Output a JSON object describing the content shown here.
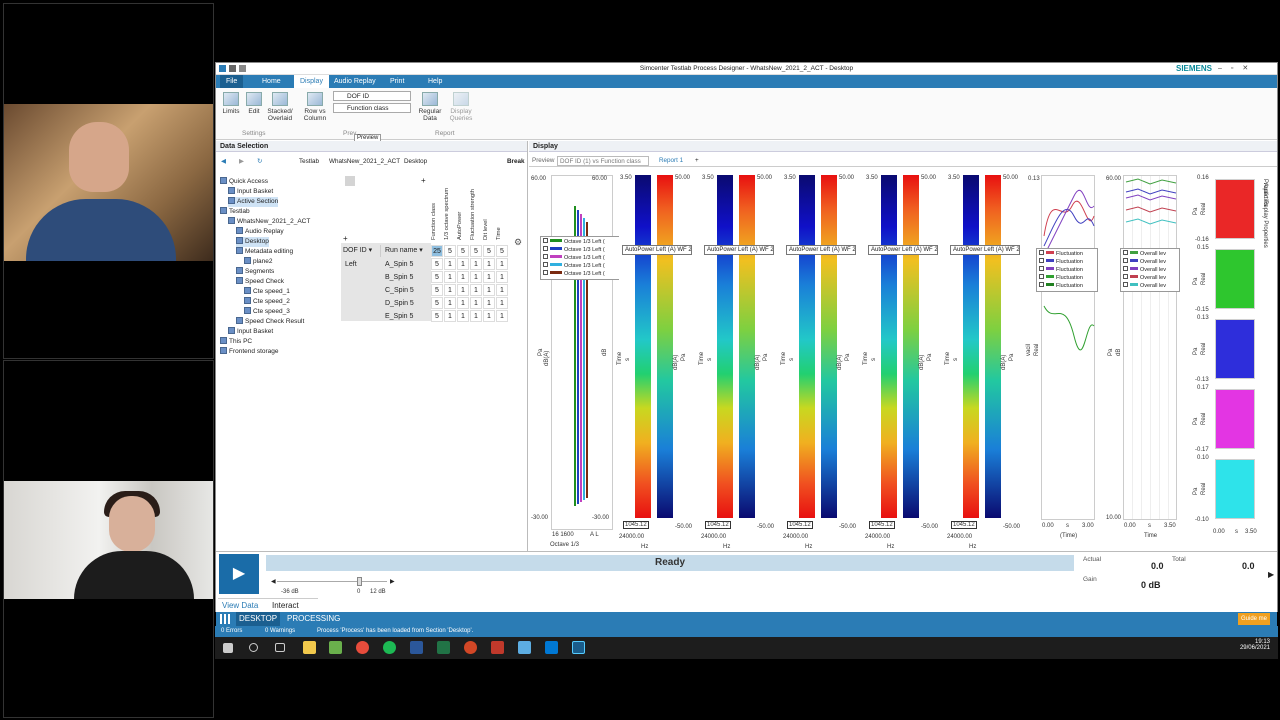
{
  "app": {
    "title": "Simcenter Testlab Process Designer - WhatsNew_2021_2_ACT - Desktop",
    "brand": "SIEMENS",
    "tabs": [
      "File",
      "Home",
      "Display",
      "Audio Replay",
      "Print",
      "Help"
    ],
    "active_tab": "Display"
  },
  "ribbon": {
    "limits": "Limits",
    "edit": "Edit",
    "stacked": "Stacked/ Overlaid",
    "rowcol": "Row vs Column",
    "dof_id": "DOF ID",
    "function_class": "Function class",
    "regular_data": "Regular Data",
    "display_queries": "Display Queries",
    "group_settings": "Settings",
    "group_preview": "Prev",
    "group_report": "Report",
    "tooltip": "Preview"
  },
  "data_selection": {
    "title": "Data Selection",
    "breadcrumb": [
      "Testlab",
      "WhatsNew_2021_2_ACT",
      "Desktop"
    ],
    "break_label": "Break",
    "tree": [
      {
        "label": "Quick Access",
        "indent": 0
      },
      {
        "label": "Input Basket",
        "indent": 1
      },
      {
        "label": "Active Section",
        "indent": 1
      },
      {
        "label": "Testlab",
        "indent": 0
      },
      {
        "label": "WhatsNew_2021_2_ACT",
        "indent": 1
      },
      {
        "label": "Audio Replay",
        "indent": 2
      },
      {
        "label": "Desktop",
        "indent": 2
      },
      {
        "label": "Metadata editing",
        "indent": 2
      },
      {
        "label": "plane2",
        "indent": 3
      },
      {
        "label": "Segments",
        "indent": 2
      },
      {
        "label": "Speed Check",
        "indent": 2
      },
      {
        "label": "Cte speed_1",
        "indent": 3
      },
      {
        "label": "Cte speed_2",
        "indent": 3
      },
      {
        "label": "Cte speed_3",
        "indent": 3
      },
      {
        "label": "Speed Check Result",
        "indent": 2
      },
      {
        "label": "Input Basket",
        "indent": 1
      },
      {
        "label": "This PC",
        "indent": 0
      },
      {
        "label": "Frontend storage",
        "indent": 0
      }
    ],
    "col_headers": [
      "Function class",
      "1/3 octave spectrum",
      "AutoPower",
      "Fluctuation strength",
      "Dit level",
      "Time"
    ],
    "grid_headers": [
      "DOF ID",
      "Run name"
    ],
    "total_row": [
      "25",
      "5",
      "5",
      "5",
      "5",
      "5"
    ],
    "rows": [
      {
        "dof": "Left",
        "run": "A_Spin 5",
        "vals": [
          "5",
          "1",
          "1",
          "1",
          "1",
          "1"
        ]
      },
      {
        "dof": "",
        "run": "B_Spin 5",
        "vals": [
          "5",
          "1",
          "1",
          "1",
          "1",
          "1"
        ]
      },
      {
        "dof": "",
        "run": "C_Spin 5",
        "vals": [
          "5",
          "1",
          "1",
          "1",
          "1",
          "1"
        ]
      },
      {
        "dof": "",
        "run": "D_Spin 5",
        "vals": [
          "5",
          "1",
          "1",
          "1",
          "1",
          "1"
        ]
      },
      {
        "dof": "",
        "run": "E_Spin 5",
        "vals": [
          "5",
          "1",
          "1",
          "1",
          "1",
          "1"
        ]
      }
    ]
  },
  "display": {
    "title": "Display",
    "preview_tab": "Preview",
    "dof_combo": "DOF ID (1) vs Function class (2)",
    "report_tab": "Report 1",
    "octave": {
      "ymax": "60.00",
      "ymin": "-30.00",
      "xmin": "16",
      "xmax": "1600",
      "xlabel": "Octave 1/3",
      "unit": "Hz",
      "ylabel": "Pa",
      "yunit": "dB(A)",
      "ymax2": "60.00",
      "ymin2": "-30.00",
      "xtick2": "A L",
      "ylabel2": "dB"
    },
    "octave_legend": [
      "Octave 1/3 Left (",
      "Octave 1/3 Left (",
      "Octave 1/3 Left (",
      "Octave 1/3 Left (",
      "Octave 1/3 Left ("
    ],
    "legend_colors": [
      "#1f8f1f",
      "#1f3fbf",
      "#c040c0",
      "#30b0e0",
      "#7a2a10"
    ],
    "spectro": [
      {
        "label": "AutoPower Left (A) WF 2",
        "tmax": "3.50",
        "cmax": "50.00",
        "cmin": "-50.00",
        "xval": "1045.12",
        "xmax": "24000.00",
        "unit": "Hz",
        "ylbl": "Time",
        "yunit": "s",
        "clbl": "dB(A)",
        "cunit": "Pa"
      },
      {
        "label": "AutoPower Left (A) WF 2",
        "tmax": "3.50",
        "cmax": "50.00",
        "cmin": "-50.00",
        "xval": "1045.12",
        "xmax": "24000.00",
        "unit": "Hz",
        "ylbl": "Time",
        "yunit": "s",
        "clbl": "dB(A)",
        "cunit": "Pa"
      },
      {
        "label": "AutoPower Left (A) WF 2",
        "tmax": "3.50",
        "cmax": "50.00",
        "cmin": "-50.00",
        "xval": "1045.12",
        "xmax": "24000.00",
        "unit": "Hz",
        "ylbl": "Time",
        "yunit": "s",
        "clbl": "dB(A)",
        "cunit": "Pa"
      },
      {
        "label": "AutoPower Left (A) WF 2",
        "tmax": "3.50",
        "cmax": "50.00",
        "cmin": "-50.00",
        "xval": "1045.12",
        "xmax": "24000.00",
        "unit": "Hz",
        "ylbl": "Time",
        "yunit": "s",
        "clbl": "dB(A)",
        "cunit": "Pa"
      },
      {
        "label": "AutoPower Left (A) WF 2",
        "tmax": "3.50",
        "cmax": "50.00",
        "cmin": "-50.00",
        "xval": "1045.12",
        "xmax": "24000.00",
        "unit": "Hz",
        "ylbl": "Time",
        "yunit": "s",
        "clbl": "dB(A)",
        "cunit": "Pa"
      }
    ],
    "fluct": {
      "ymax": "0.13",
      "xmin": "0.00",
      "xmid": "s",
      "xmax": "3.00",
      "xlabel": "(Time)",
      "legend": [
        "Fluctuation",
        "Fluctuation",
        "Fluctuation",
        "Fluctuation",
        "Fluctuation"
      ],
      "ylabel": "vacil",
      "yunit": "Real"
    },
    "overall": {
      "ymax": "60.00",
      "ymin": "10.00",
      "xmin": "0.00",
      "xmid": "s",
      "xmax": "3.50",
      "xlabel": "Time",
      "legend": [
        "Overall lev",
        "Overall lev",
        "Overall lev",
        "Overall lev",
        "Overall lev"
      ],
      "ylabel": "Pa",
      "yunit": "dB"
    },
    "timetraces": {
      "xmin": "0.00",
      "xmid": "s",
      "xmax": "3.50",
      "ylabel": "Pa",
      "yunit": "Real",
      "traces": [
        {
          "color": "#e81010",
          "top": "0.16",
          "bot": "-0.16"
        },
        {
          "color": "#18c018",
          "top": "0.15",
          "bot": "-0.15"
        },
        {
          "color": "#1818d8",
          "top": "0.13",
          "bot": "-0.13"
        },
        {
          "color": "#e020e0",
          "top": "0.17",
          "bot": "-0.17"
        },
        {
          "color": "#18e0e8",
          "top": "0.10",
          "bot": "-0.10"
        }
      ]
    }
  },
  "bottom": {
    "status": "Ready",
    "actual_label": "Actual",
    "actual_value": "0.0",
    "total_label": "Total",
    "total_value": "0.0",
    "gain_label": "Gain",
    "gain_value": "0 dB",
    "slider_min": "-36 dB",
    "slider_mid": "0",
    "slider_max": "12 dB",
    "tab_view": "View Data",
    "tab_interact": "Interact"
  },
  "status_strip": {
    "desktop": "DESKTOP",
    "processing": "PROCESSING",
    "errors": "0 Errors",
    "warnings": "0 Warnings",
    "message": "Process 'Process' has been loaded from Section 'Desktop'.",
    "guide": "Guide me"
  },
  "taskbar": {
    "time": "19:13",
    "date": "29/06/2021"
  },
  "side_tabs": [
    "Properties",
    "Audio Replay Properties"
  ]
}
